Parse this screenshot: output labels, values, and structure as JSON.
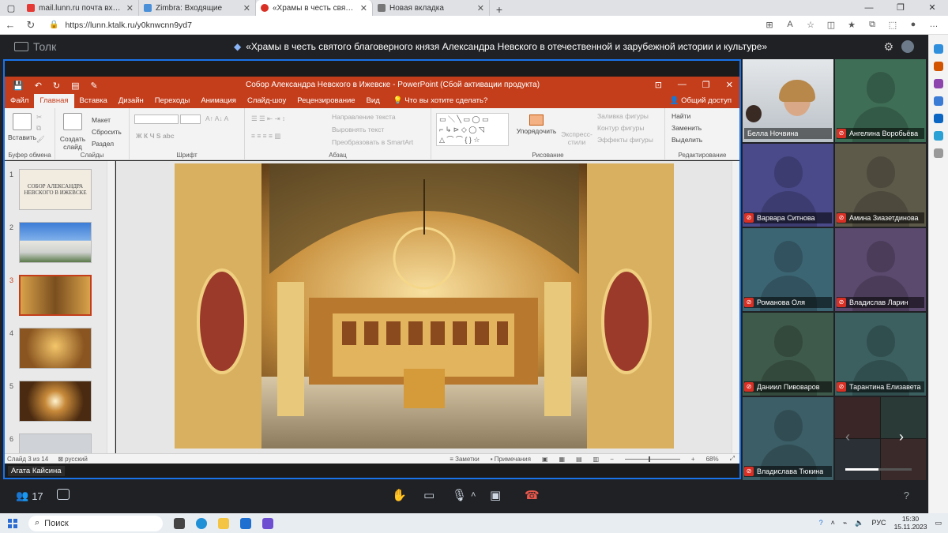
{
  "browser": {
    "tabs": [
      {
        "label": "mail.lunn.ru почта вход — Яндекс",
        "color": "#e53935"
      },
      {
        "label": "Zimbra: Входящие",
        "color": "#4a90d9"
      },
      {
        "label": "«Храмы в честь святого бла",
        "color": "#d93025",
        "active": true
      },
      {
        "label": "Новая вкладка",
        "color": "#777777"
      }
    ],
    "url": "https://lunn.ktalk.ru/y0knwcnn9yd7"
  },
  "app": {
    "brand": "Толк",
    "conference_title": "«Храмы в честь святого благоверного князя Александра Невского в отечественной и зарубежной истории и культуре»"
  },
  "powerpoint": {
    "window_title": "Собор Александра Невского в Ижевске - PowerPoint (Сбой активации продукта)",
    "tabs": [
      "Файл",
      "Главная",
      "Вставка",
      "Дизайн",
      "Переходы",
      "Анимация",
      "Слайд-шоу",
      "Рецензирование",
      "Вид"
    ],
    "active_tab": "Главная",
    "tell_me": "Что вы хотите сделать?",
    "share": "Общий доступ",
    "ribbon": {
      "paste": "Вставить",
      "clipboard": "Буфер обмена",
      "new_slide": "Создать слайд",
      "layout": "Макет",
      "reset": "Сбросить",
      "section": "Раздел",
      "slides": "Слайды",
      "font": "Шрифт",
      "text_direction": "Направление текста",
      "align_text": "Выровнять текст",
      "smartart": "Преобразовать в SmartArt",
      "paragraph": "Абзац",
      "arrange": "Упорядочить",
      "quick_styles": "Экспресс-стили",
      "shape_fill": "Заливка фигуры",
      "shape_outline": "Контур фигуры",
      "shape_effects": "Эффекты фигуры",
      "drawing": "Рисование",
      "find": "Найти",
      "replace": "Заменить",
      "select": "Выделить",
      "editing": "Редактирование"
    },
    "thumbnails": [
      {
        "num": "1",
        "title": "СОБОР АЛЕКСАНДРА НЕВСКОГО В ИЖЕВСКЕ"
      },
      {
        "num": "2"
      },
      {
        "num": "3",
        "selected": true
      },
      {
        "num": "4"
      },
      {
        "num": "5"
      },
      {
        "num": "6"
      }
    ],
    "status": {
      "slide": "Слайд 3 из 14",
      "lang": "русский",
      "notes": "Заметки",
      "comments": "Примечания",
      "zoom": "68%"
    }
  },
  "presenter": "Агата Кайсина",
  "participants": [
    {
      "name": "Белла Ночвина",
      "color": "#cfd6dc",
      "video": true,
      "muted": false
    },
    {
      "name": "Ангелина Воробьёва",
      "color": "#3f6e56",
      "muted": true
    },
    {
      "name": "Варвара Ситнова",
      "color": "#4a4a8a",
      "muted": true
    },
    {
      "name": "Амина Зиазетдинова",
      "color": "#5e5a4a",
      "muted": true
    },
    {
      "name": "Романова Оля",
      "color": "#3c6573",
      "muted": true
    },
    {
      "name": "Владислав Ларин",
      "color": "#5c4a6e",
      "muted": true
    },
    {
      "name": "Даниил Пивоваров",
      "color": "#3e5a4a",
      "muted": true
    },
    {
      "name": "Тарантина Елизавета",
      "color": "#3c6060",
      "muted": true
    },
    {
      "name": "Владислава Тюкина",
      "color": "#3c5e66",
      "muted": true
    }
  ],
  "callbar": {
    "participants_count": "17",
    "help": "?"
  },
  "taskbar": {
    "search": "Поиск",
    "lang": "РУС",
    "time": "15:30",
    "date": "15.11.2023"
  }
}
